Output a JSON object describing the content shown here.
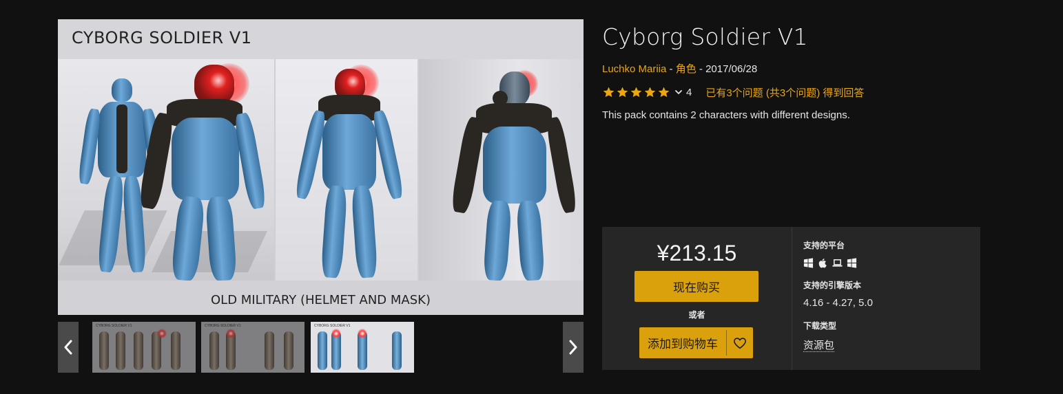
{
  "gallery": {
    "hero_title": "CYBORG SOLDIER V1",
    "hero_caption": "OLD MILITARY (HELMET AND MASK)",
    "thumb_titles": [
      "CYBORG SOLDIER V1",
      "CYBORG SOLDIER V1",
      "CYBORG SOLDIER V1"
    ],
    "prev_icon": "chevron-left-icon",
    "next_icon": "chevron-right-icon"
  },
  "product": {
    "title": "Cyborg Soldier V1",
    "author": "Luchko Mariia",
    "category": "角色",
    "sep": " - ",
    "date": "2017/06/28",
    "rating_stars": 5,
    "rating_count": "4",
    "qa_text": "已有3个问题 (共3个问题) 得到回答",
    "description": "This pack contains 2 characters with different designs."
  },
  "purchase": {
    "price": "¥213.15",
    "buy_now": "现在购买",
    "or": "或者",
    "add_to_cart": "添加到购物车",
    "wishlist_icon": "heart-icon"
  },
  "specs": {
    "platforms_label": "支持的平台",
    "platform_icons": [
      "windows-icon",
      "apple-icon",
      "laptop-icon",
      "windows-icon"
    ],
    "engine_label": "支持的引擎版本",
    "engine_versions": "4.16 - 4.27, 5.0",
    "download_label": "下载类型",
    "download_type": "资源包"
  },
  "colors": {
    "background": "#111111",
    "accent": "#dba10c",
    "link": "#e8a713",
    "panel": "#262626"
  }
}
